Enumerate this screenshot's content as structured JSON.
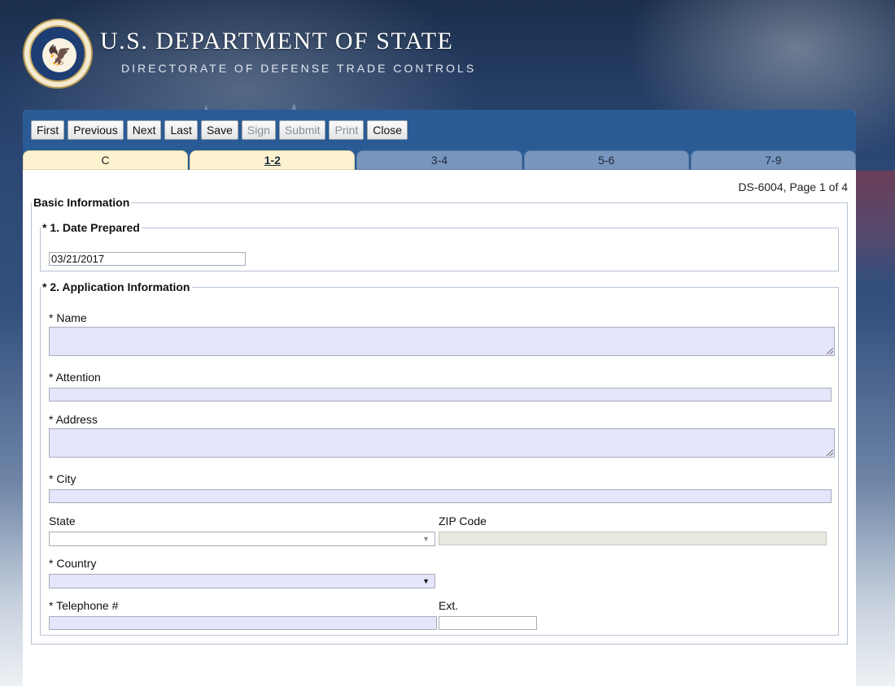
{
  "header": {
    "title": "U.S. DEPARTMENT OF STATE",
    "subtitle": "DIRECTORATE OF DEFENSE TRADE CONTROLS",
    "seal_icon": "state-department-seal"
  },
  "toolbar": {
    "buttons": [
      {
        "label": "First",
        "enabled": true
      },
      {
        "label": "Previous",
        "enabled": true
      },
      {
        "label": "Next",
        "enabled": true
      },
      {
        "label": "Last",
        "enabled": true
      },
      {
        "label": "Save",
        "enabled": true
      },
      {
        "label": "Sign",
        "enabled": false
      },
      {
        "label": "Submit",
        "enabled": false
      },
      {
        "label": "Print",
        "enabled": false
      },
      {
        "label": "Close",
        "enabled": true
      }
    ]
  },
  "tabs": [
    {
      "label": "C",
      "state": "done"
    },
    {
      "label": "1-2",
      "state": "active"
    },
    {
      "label": "3-4",
      "state": "pending"
    },
    {
      "label": "5-6",
      "state": "pending"
    },
    {
      "label": "7-9",
      "state": "pending"
    }
  ],
  "page_info": "DS-6004, Page 1 of 4",
  "form": {
    "section_title": "Basic Information",
    "date_prepared": {
      "legend": "* 1. Date Prepared",
      "value": "03/21/2017"
    },
    "application": {
      "legend": "* 2. Application Information",
      "name_label": "* Name",
      "attention_label": "* Attention",
      "address_label": "* Address",
      "city_label": "* City",
      "state_label": "State",
      "zip_label": "ZIP Code",
      "country_label": "* Country",
      "telephone_label": "* Telephone #",
      "ext_label": "Ext."
    }
  },
  "colors": {
    "toolbar_bg": "#2a5b94",
    "required_field_bg": "#e5e5fb",
    "active_tab_bg": "#fdf2d0"
  }
}
